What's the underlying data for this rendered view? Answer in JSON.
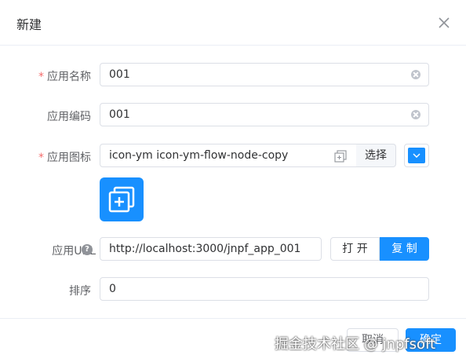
{
  "dialog": {
    "title": "新建"
  },
  "form": {
    "app_name": {
      "label": "应用名称",
      "required": true,
      "value": "001"
    },
    "app_code": {
      "label": "应用编码",
      "required": false,
      "value": "001"
    },
    "app_icon": {
      "label": "应用图标",
      "required": true,
      "value": "icon-ym icon-ym-flow-node-copy",
      "select_label": "选择",
      "icon_color": "#1890ff"
    },
    "app_url": {
      "label": "应用URL",
      "value": "http://localhost:3000/jnpf_app_001",
      "open_label": "打 开",
      "copy_label": "复 制"
    },
    "sort": {
      "label": "排序",
      "value": "0"
    }
  },
  "footer": {
    "cancel_label": "取消",
    "confirm_label": "确定"
  },
  "watermark": "掘金技术社区 @ jnpfsoft",
  "colors": {
    "primary": "#1890ff",
    "required": "#f56c6c"
  }
}
